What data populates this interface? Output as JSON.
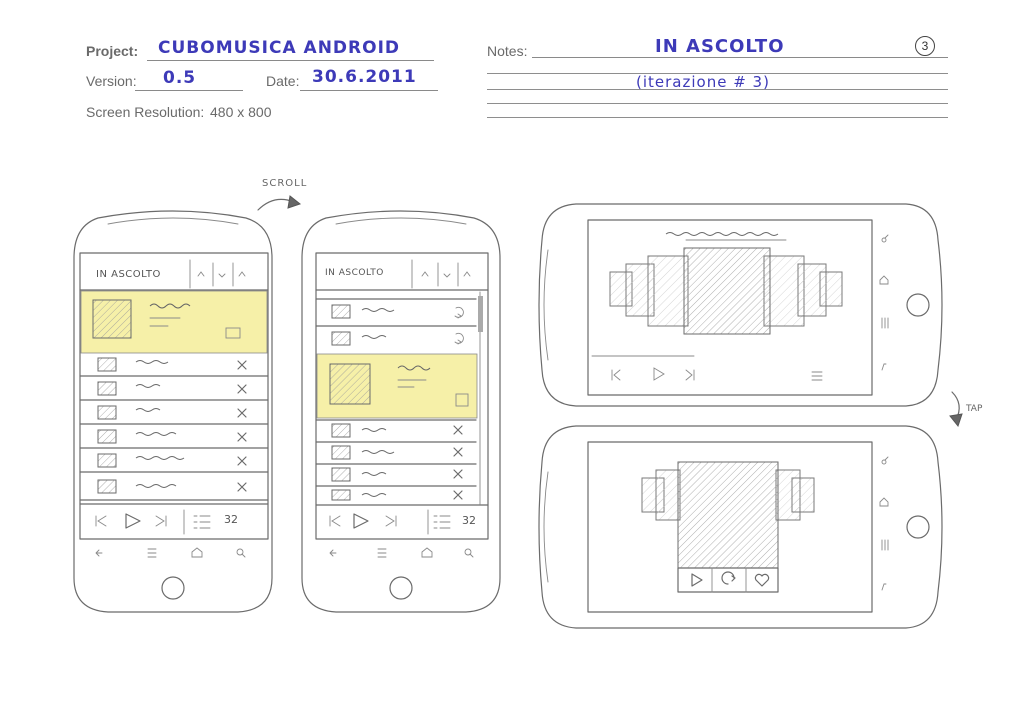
{
  "header": {
    "project_label": "Project:",
    "project_value": "CUBOMUSICA ANDROID",
    "version_label": "Version:",
    "version_value": "0.5",
    "date_label": "Date:",
    "date_value": "30.6.2011",
    "resolution_label": "Screen Resolution:",
    "resolution_value": "480 x 800",
    "notes_label": "Notes:",
    "notes_line1": "IN ASCOLTO",
    "notes_line2": "(iterazione # 3)",
    "page_number": "3"
  },
  "annotations": {
    "scroll": "SCROLL",
    "tap": "TAP"
  },
  "phone1": {
    "title": "IN ASCOLTO",
    "counter": "32"
  },
  "phone2": {
    "title": "IN ASCOLTO",
    "counter": "32"
  },
  "colors": {
    "highlight": "#f6f0a8",
    "pen": "#3d3ab8",
    "pencil": "#6b6b6b"
  }
}
